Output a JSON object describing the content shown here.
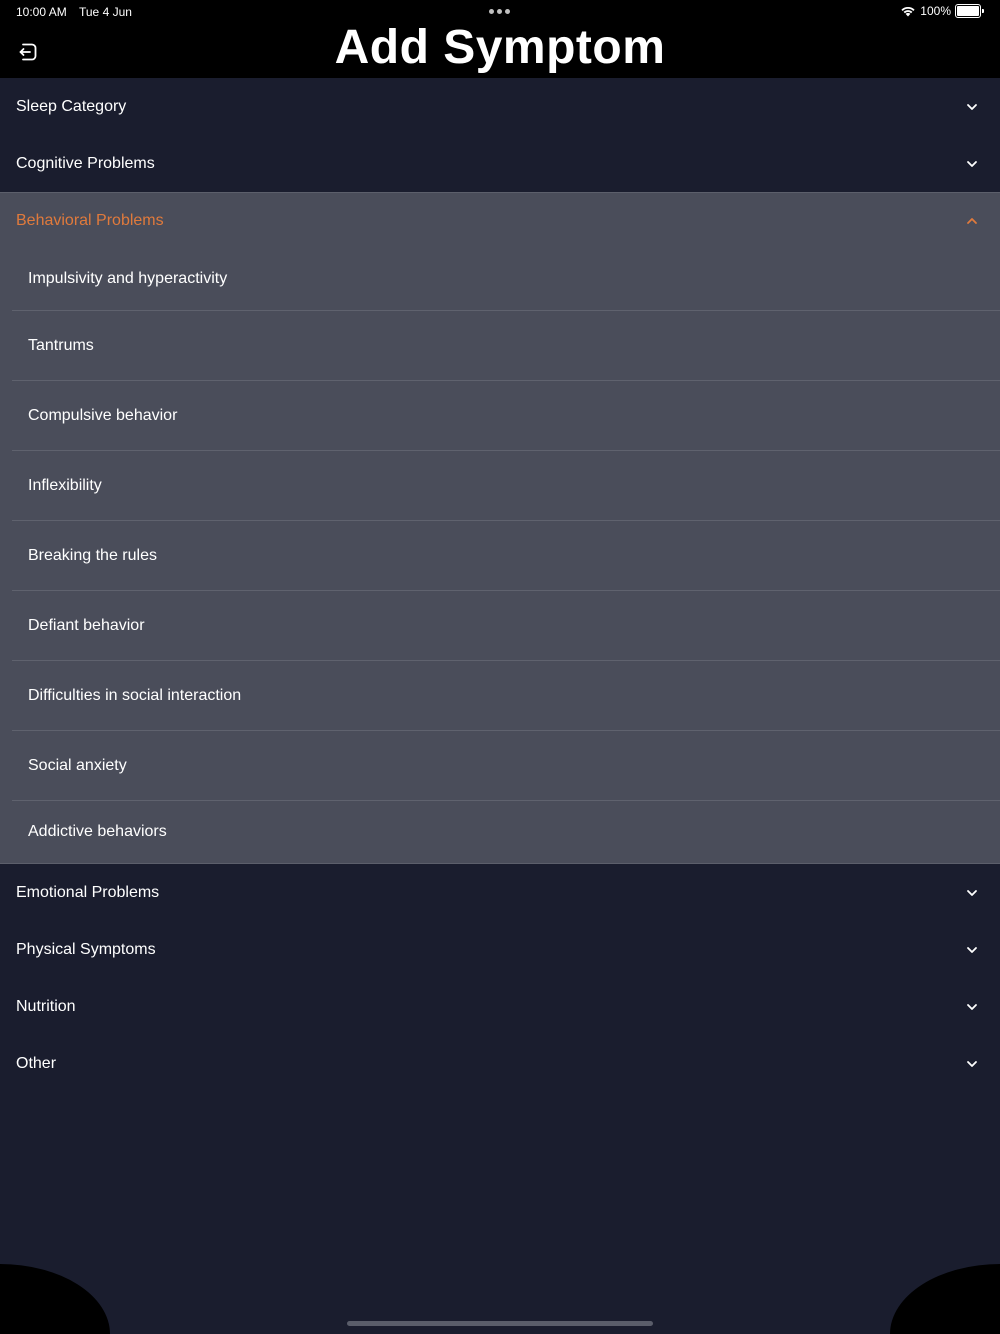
{
  "status_bar": {
    "time": "10:00 AM",
    "date": "Tue 4 Jun",
    "battery_percent": "100%",
    "battery_level": 1.0
  },
  "header": {
    "title": "Add Symptom",
    "back_icon": "exit-icon"
  },
  "categories_top": [
    {
      "label": "Sleep Category",
      "icon": "chevron-down-icon"
    },
    {
      "label": "Cognitive Problems",
      "icon": "chevron-down-icon"
    }
  ],
  "expanded": {
    "label": "Behavioral Problems",
    "icon": "chevron-up-icon",
    "accent_color": "#e07a3c",
    "items": [
      "Impulsivity and hyperactivity",
      "Tantrums",
      "Compulsive behavior",
      "Inflexibility",
      "Breaking the rules",
      "Defiant behavior",
      "Difficulties in social interaction",
      "Social anxiety",
      "Addictive behaviors"
    ]
  },
  "categories_bottom": [
    {
      "label": "Emotional Problems",
      "icon": "chevron-down-icon"
    },
    {
      "label": "Physical Symptoms",
      "icon": "chevron-down-icon"
    },
    {
      "label": "Nutrition",
      "icon": "chevron-down-icon"
    },
    {
      "label": "Other",
      "icon": "chevron-down-icon"
    }
  ],
  "colors": {
    "background": "#1a1d2e",
    "expanded_background": "#4a4d5a",
    "accent": "#e07a3c",
    "text": "#ffffff"
  }
}
